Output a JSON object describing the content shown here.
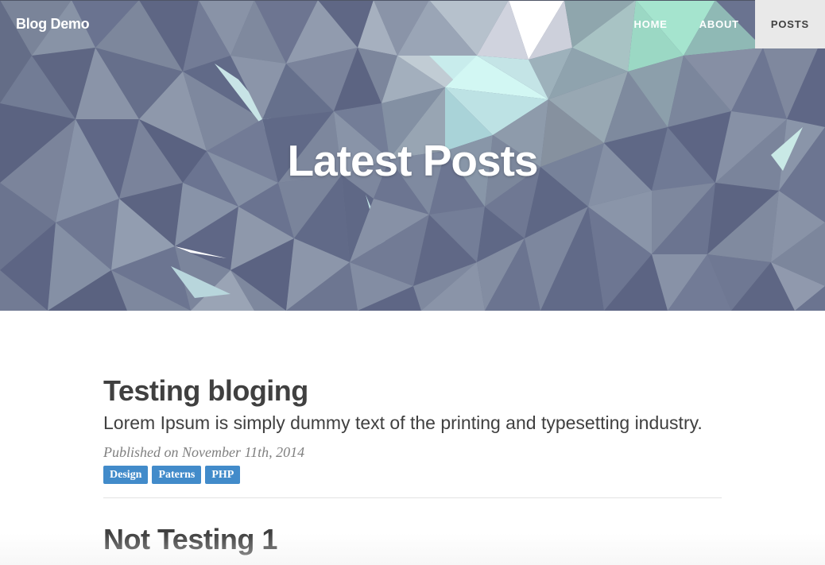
{
  "header": {
    "brand": "Blog Demo",
    "nav": [
      {
        "label": "HOME",
        "active": false
      },
      {
        "label": "ABOUT",
        "active": false
      },
      {
        "label": "POSTS",
        "active": true
      }
    ],
    "title": "Latest Posts"
  },
  "posts": [
    {
      "title": "Testing bloging",
      "subtitle": "Lorem Ipsum is simply dummy text of the printing and typesetting industry.",
      "meta": "Published on November 11th, 2014",
      "tags": [
        "Design",
        "Paterns",
        "PHP"
      ]
    },
    {
      "title": "Not Testing 1"
    }
  ],
  "colors": {
    "tag_background": "#428bca",
    "active_nav_background": "#e9e9e9",
    "text": "#404040",
    "meta": "#808080"
  }
}
